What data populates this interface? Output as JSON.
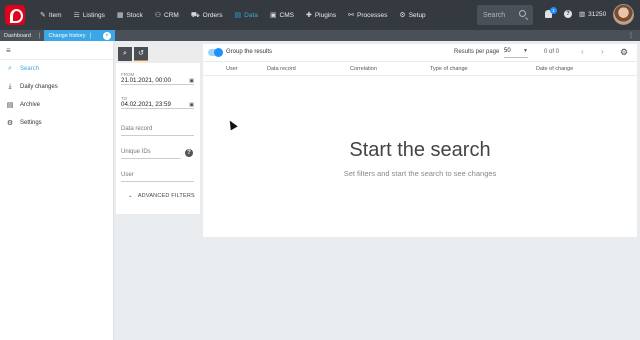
{
  "topnav": {
    "items": [
      {
        "label": "Item",
        "icon": "tag-icon"
      },
      {
        "label": "Listings",
        "icon": "list-icon"
      },
      {
        "label": "Stock",
        "icon": "stock-icon"
      },
      {
        "label": "CRM",
        "icon": "crm-icon"
      },
      {
        "label": "Orders",
        "icon": "cart-icon"
      },
      {
        "label": "Data",
        "icon": "database-icon"
      },
      {
        "label": "CMS",
        "icon": "cms-icon"
      },
      {
        "label": "Plugins",
        "icon": "puzzle-icon"
      },
      {
        "label": "Processes",
        "icon": "process-icon"
      },
      {
        "label": "Setup",
        "icon": "gear-icon"
      }
    ],
    "active_index": 5,
    "search_placeholder": "Search",
    "notification_count": "1",
    "account_id": "31250",
    "accent_color": "#3ba7e6"
  },
  "tabs": {
    "dashboard": "Dashboard",
    "active": "Change history"
  },
  "sidebar": {
    "items": [
      {
        "label": "Search",
        "icon": "search-icon"
      },
      {
        "label": "Daily changes",
        "icon": "download-icon"
      },
      {
        "label": "Archive",
        "icon": "archive-icon"
      },
      {
        "label": "Settings",
        "icon": "settings-icon"
      }
    ]
  },
  "filters": {
    "from_label": "FROM",
    "from_value": "21.01.2021, 00:00",
    "to_label": "TO",
    "to_value": "04.02.2021, 23:59",
    "data_record_placeholder": "Data record",
    "unique_ids_placeholder": "Unique IDs",
    "user_placeholder": "User",
    "advanced_label": "ADVANCED FILTERS"
  },
  "results": {
    "group_label": "Group the results",
    "rpp_label": "Results per page",
    "rpp_value": "50",
    "pager_text": "0 of 0",
    "columns": [
      "User",
      "Data record",
      "Correlation",
      "Type of change",
      "Date of change"
    ],
    "empty_title": "Start the search",
    "empty_subtitle": "Set filters and start the search to see changes"
  }
}
